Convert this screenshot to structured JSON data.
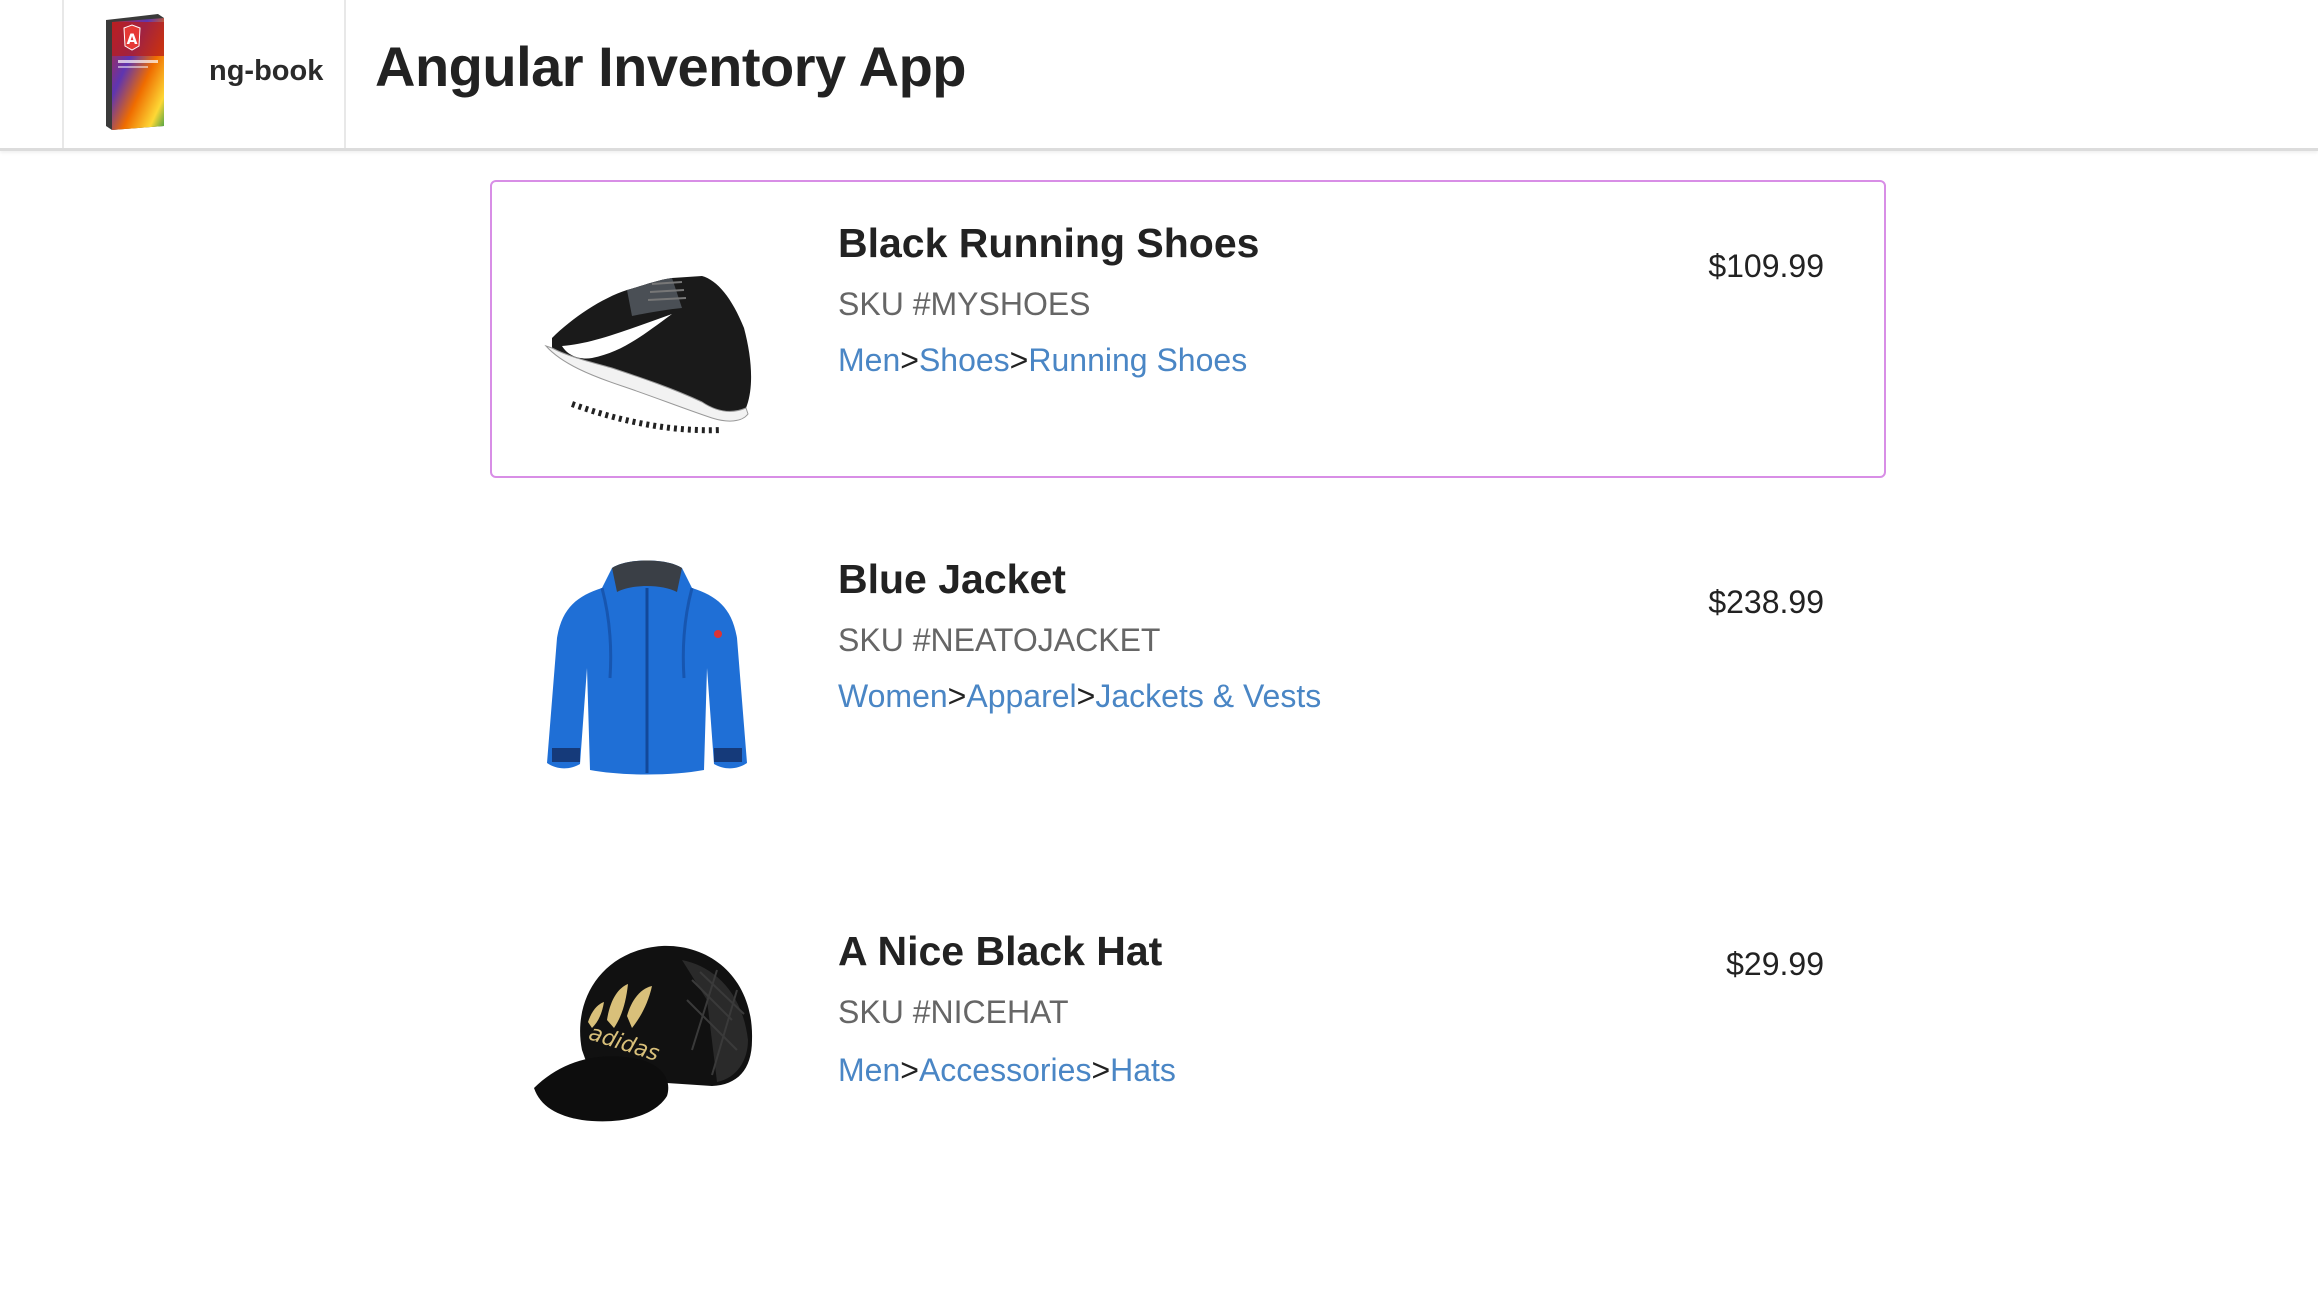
{
  "header": {
    "brand_name": "ng-book",
    "app_title": "Angular Inventory App",
    "logo_icon": "ng-book-cover-icon"
  },
  "products": [
    {
      "name": "Black Running Shoes",
      "sku": "SKU #MYSHOES",
      "price": "$109.99",
      "image_icon": "running-shoe-icon",
      "departments": [
        "Men",
        "Shoes",
        "Running Shoes"
      ],
      "separator": ">",
      "selected": true
    },
    {
      "name": "Blue Jacket",
      "sku": "SKU #NEATOJACKET",
      "price": "$238.99",
      "image_icon": "jacket-icon",
      "departments": [
        "Women",
        "Apparel",
        "Jackets & Vests"
      ],
      "separator": ">",
      "selected": false
    },
    {
      "name": "A Nice Black Hat",
      "sku": "SKU #NICEHAT",
      "price": "$29.99",
      "image_icon": "cap-icon",
      "departments": [
        "Men",
        "Accessories",
        "Hats"
      ],
      "separator": ">",
      "selected": false
    }
  ],
  "colors": {
    "link": "#4a86c5",
    "selected_border": "#d88ee6",
    "sku": "#666666"
  }
}
